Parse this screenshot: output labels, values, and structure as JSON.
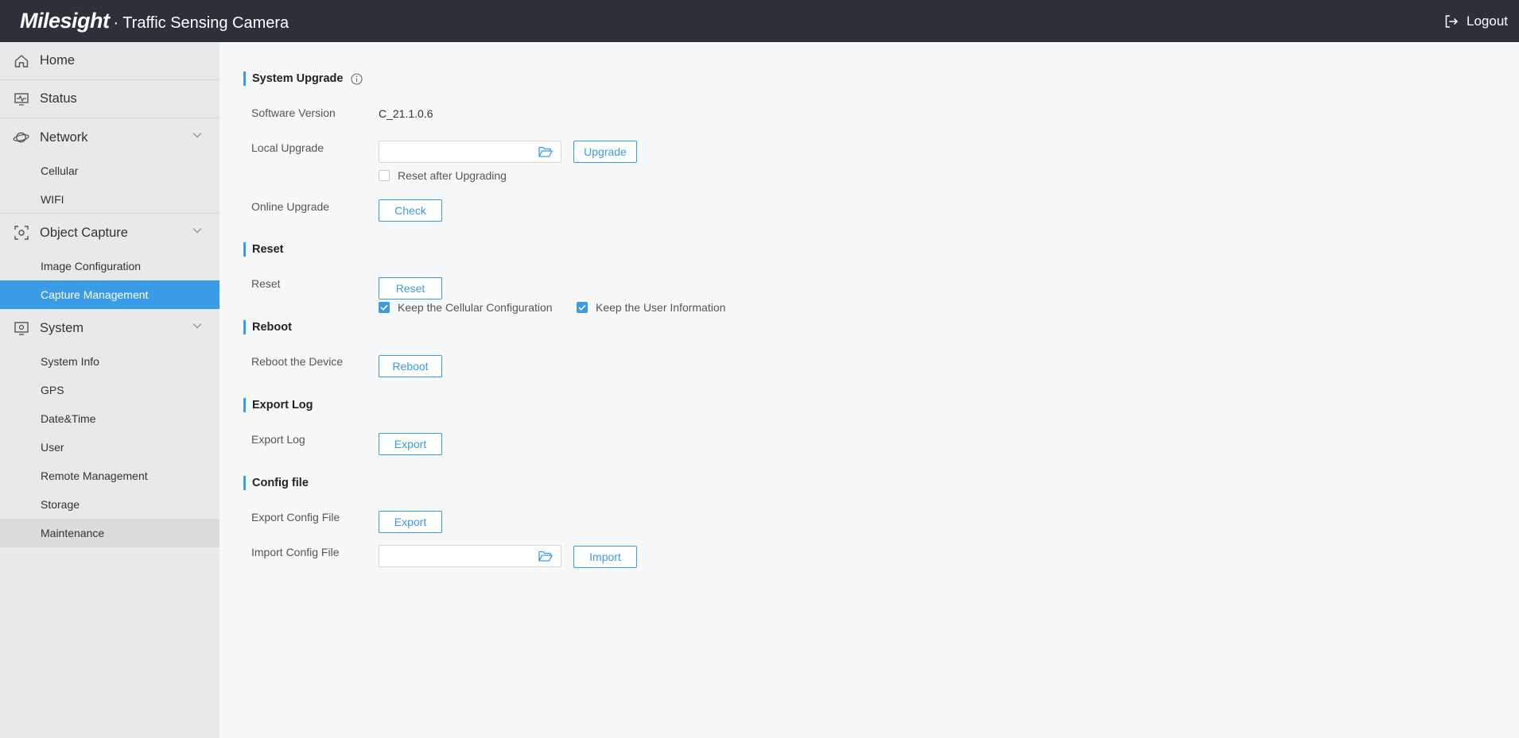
{
  "header": {
    "logo": "Milesight",
    "separator": "·",
    "title": "Traffic Sensing Camera",
    "logout_label": "Logout"
  },
  "sidebar": {
    "home": "Home",
    "status": "Status",
    "network": {
      "label": "Network",
      "items": [
        "Cellular",
        "WIFI"
      ]
    },
    "object_capture": {
      "label": "Object Capture",
      "items": [
        "Image Configuration",
        "Capture Management"
      ]
    },
    "system": {
      "label": "System",
      "items": [
        "System Info",
        "GPS",
        "Date&Time",
        "User",
        "Remote Management",
        "Storage",
        "Maintenance"
      ]
    }
  },
  "main": {
    "system_upgrade": {
      "title": "System Upgrade",
      "software_version_label": "Software Version",
      "software_version_value": "C_21.1.0.6",
      "local_upgrade_label": "Local Upgrade",
      "local_upgrade_file_value": "",
      "upgrade_button": "Upgrade",
      "reset_after_upgrading_label": "Reset after Upgrading",
      "reset_after_upgrading_checked": false,
      "online_upgrade_label": "Online Upgrade",
      "check_button": "Check"
    },
    "reset": {
      "title": "Reset",
      "reset_label": "Reset",
      "reset_button": "Reset",
      "keep_cellular_label": "Keep the Cellular Configuration",
      "keep_cellular_checked": true,
      "keep_user_label": "Keep the User Information",
      "keep_user_checked": true
    },
    "reboot": {
      "title": "Reboot",
      "reboot_label": "Reboot the Device",
      "reboot_button": "Reboot"
    },
    "export_log": {
      "title": "Export Log",
      "export_label": "Export Log",
      "export_button": "Export"
    },
    "config_file": {
      "title": "Config file",
      "export_label": "Export Config File",
      "export_button": "Export",
      "import_label": "Import Config File",
      "import_file_value": "",
      "import_button": "Import"
    }
  },
  "colors": {
    "header_bg": "#2c3038",
    "accent": "#3a9be6",
    "sidebar_bg": "#e9e9e9",
    "main_bg": "#f7f8f9"
  }
}
